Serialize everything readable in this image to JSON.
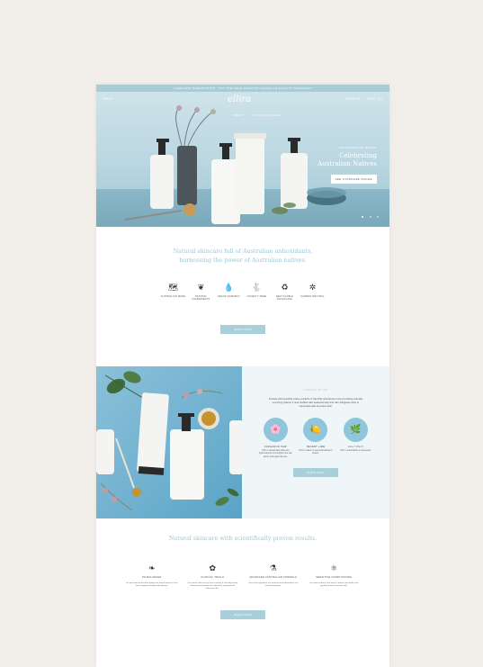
{
  "announcement": "COMPLETE RESERVATION · PAY THE FREE SHIPPING RANGE ON ELITE AT MERCHANT",
  "nav": {
    "left": "SHOP",
    "logo": "ellira",
    "right": [
      "SEARCH",
      "CART (0)"
    ],
    "sub": [
      "ABOUT",
      "STORY & VALUES"
    ]
  },
  "hero": {
    "eyebrow": "THE STARGAZE RANGE",
    "headline": "Celebrating Australian Natives",
    "button": "SEE STARGAZE RANGE",
    "slides": 3
  },
  "intro": {
    "headline": "Natural skincare full of Australian antioxidants, harnessing the power of Australian natives."
  },
  "features": [
    {
      "icon": "australia-icon",
      "glyph": "🗺",
      "label": "AUSTRALIAN MADE"
    },
    {
      "icon": "leaf-icon",
      "glyph": "❦",
      "label": "NATURAL INGREDIENTS"
    },
    {
      "icon": "drop-icon",
      "glyph": "💧",
      "label": "VEGAN FRIENDLY"
    },
    {
      "icon": "rabbit-icon",
      "glyph": "🐇",
      "label": "CRUELTY FREE"
    },
    {
      "icon": "recycle-icon",
      "glyph": "♻",
      "label": "RECYCLABLE PACKAGING"
    },
    {
      "icon": "carbon-icon",
      "glyph": "✲",
      "label": "CARBON NEUTRAL"
    }
  ],
  "intro_button": "SHOP NOW",
  "split": {
    "eyebrow": "KAKADU PLUM",
    "body": "Infused with beautiful native extracts of Lilly Pilly and Desert Lime providing naturally occurring vitamin C and fortified with seaweed kelp and rare Kangaroo Paw to rejuvenate skin & protect skin.",
    "ingredients": [
      {
        "icon": "kangaroo-paw-icon",
        "glyph": "🌸",
        "name": "KANGAROO PAW",
        "desc": "Rich in natural fatty acids and phytonutrients to strengthen the skin barrier and repair dryness.",
        "color": "#8fc6db"
      },
      {
        "icon": "desert-lime-icon",
        "glyph": "🍋",
        "name": "DESERT LIME",
        "desc": "Rich in vitamin C and antioxidants to protect.",
        "color": "#8fc6db"
      },
      {
        "icon": "lilly-pilly-icon",
        "glyph": "🌿",
        "name": "LILLY PILLY",
        "desc": "Rich in antioxidants to rejuvenate.",
        "color": "#8fc6db"
      }
    ],
    "button": "SHOP NOW"
  },
  "benefits": {
    "headline": "Natural skincare with scientifically proven results.",
    "items": [
      {
        "icon": "vegan-leaf-icon",
        "glyph": "❧",
        "name": "PH BALANCED",
        "desc": "Our pH balanced formulas protect the natural barrier of your skin, keeping it healthy and hydrated."
      },
      {
        "icon": "clinical-icon",
        "glyph": "✿",
        "name": "CLINICAL TRIALS",
        "desc": "Our natural skincare has been carefully & clinically tested, delivering amazing results with clean, hydrated and balanced skin."
      },
      {
        "icon": "flask-icon",
        "glyph": "⚗",
        "name": "ADVANCED AUSTRALIAN FORMULA",
        "desc": "Our active ingredients are sourced across Australia's rich natural landscape."
      },
      {
        "icon": "molecule-icon",
        "glyph": "⚛",
        "name": "SENSITIVE CONDITIONING",
        "desc": "Our native extracts have been in nature specifically to be gentle & nourish sensitive skin."
      }
    ],
    "button": "SHOP NOW"
  }
}
